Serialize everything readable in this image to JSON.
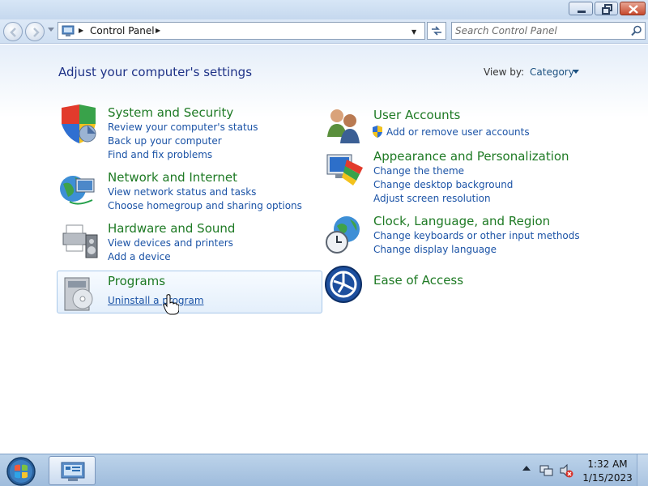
{
  "window": {
    "minimize_icon": "minimize-icon",
    "maximize_icon": "restore-icon",
    "close_icon": "close-icon"
  },
  "navigation": {
    "back_icon": "back-arrow-icon",
    "forward_icon": "forward-arrow-icon",
    "address_path": "Control Panel",
    "search_placeholder": "Search Control Panel"
  },
  "header": {
    "title": "Adjust your computer's settings",
    "view_by_label": "View by:",
    "view_by_value": "Category"
  },
  "categories": [
    {
      "title": "System and Security",
      "icon": "shield-icon",
      "links": [
        "Review your computer's status",
        "Back up your computer",
        "Find and fix problems"
      ]
    },
    {
      "title": "Network and Internet",
      "icon": "network-globe-icon",
      "links": [
        "View network status and tasks",
        "Choose homegroup and sharing options"
      ]
    },
    {
      "title": "Hardware and Sound",
      "icon": "printer-speaker-icon",
      "links": [
        "View devices and printers",
        "Add a device"
      ]
    },
    {
      "title": "Programs",
      "icon": "programs-disc-icon",
      "links": [
        "Uninstall a program"
      ]
    },
    {
      "title": "User Accounts",
      "icon": "users-icon",
      "links": [
        "Add or remove user accounts"
      ]
    },
    {
      "title": "Appearance and Personalization",
      "icon": "monitor-paint-icon",
      "links": [
        "Change the theme",
        "Change desktop background",
        "Adjust screen resolution"
      ]
    },
    {
      "title": "Clock, Language, and Region",
      "icon": "globe-clock-icon",
      "links": [
        "Change keyboards or other input methods",
        "Change display language"
      ]
    },
    {
      "title": "Ease of Access",
      "icon": "ease-of-access-icon",
      "links": []
    }
  ],
  "taskbar": {
    "start_icon": "windows-start-orb-icon",
    "pinned_icon": "control-panel-icon",
    "time": "1:32 AM",
    "date": "1/15/2023"
  },
  "colors": {
    "heading": "#1e3287",
    "category_title": "#1e7a24",
    "link": "#1b53a6",
    "highlight_border": "#a9c9ea"
  }
}
